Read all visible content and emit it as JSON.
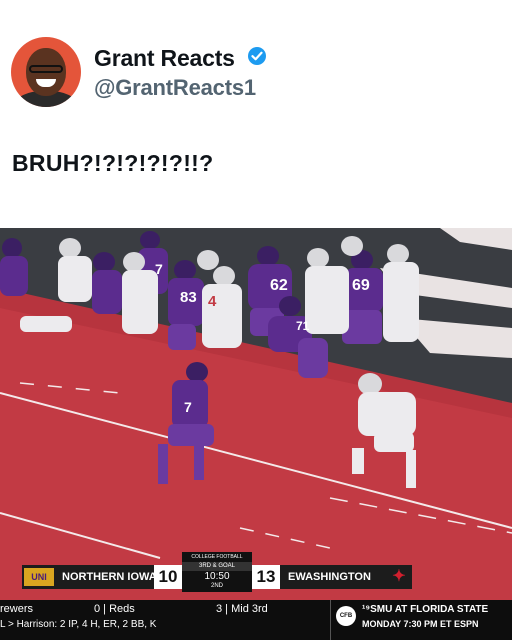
{
  "tweet": {
    "display_name": "Grant Reacts",
    "handle": "@GrantReacts1",
    "text": "BRUH?!?!?!?!?!!?",
    "verified_color": "#1d9bf0",
    "avatar_bg": "#e4553a"
  },
  "video": {
    "jerseys": [
      "62",
      "69",
      "83",
      "4",
      "7",
      "71",
      "7"
    ],
    "scorebug": {
      "league": "COLLEGE FOOTBALL",
      "home_team": "NORTHERN IOWA",
      "home_logo": "UNI",
      "home_score": "10",
      "down_distance": "3RD & GOAL",
      "clock": "10:50",
      "quarter": "2ND",
      "away_score": "13",
      "away_team": "EWASHINGTON"
    },
    "ticker": {
      "team_left": "rewers",
      "team_mid": "0 | Reds",
      "stat_line": "L > Harrison: 2 IP, 4 H, ER, 2 BB, K",
      "inning": "3 | Mid 3rd",
      "promo_logo": "CFB",
      "promo_title": "¹⁹SMU AT FLORIDA STATE",
      "promo_time": "MONDAY 7:30 PM ET ESPN"
    }
  }
}
